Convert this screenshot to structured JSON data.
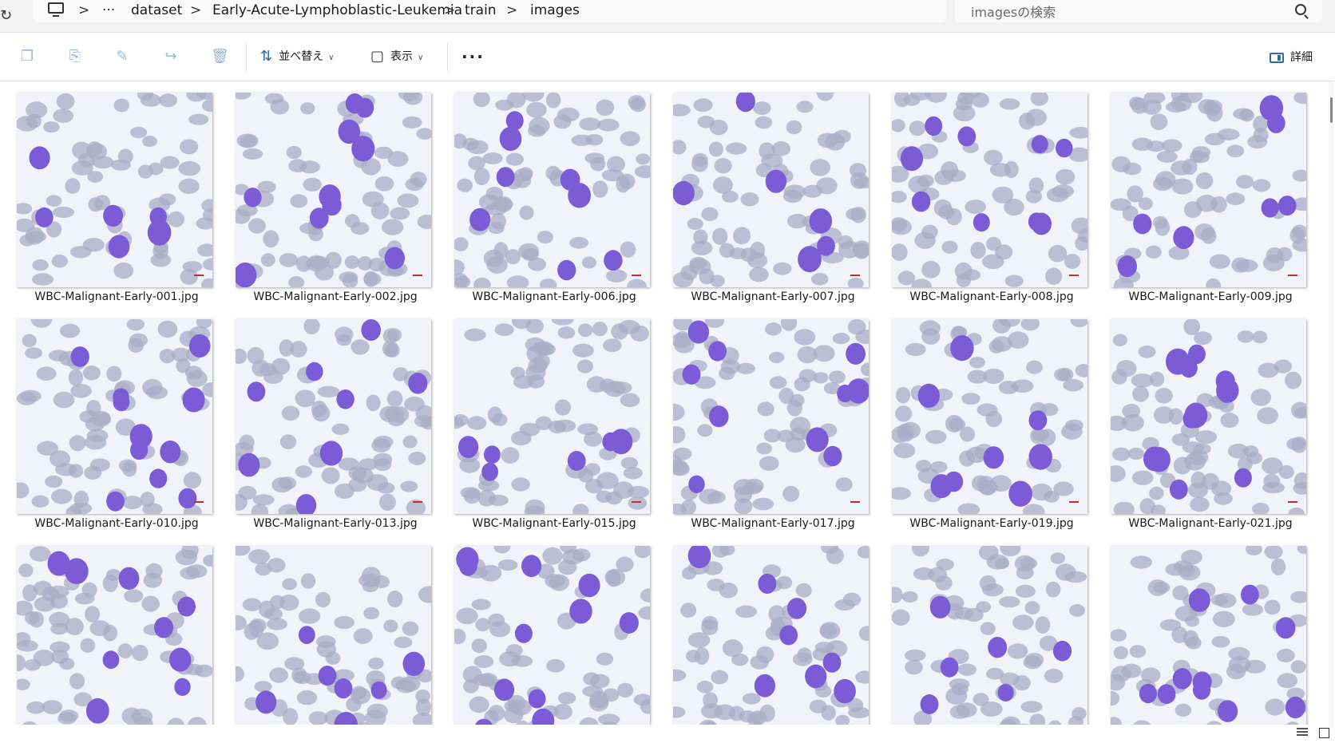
{
  "window": {
    "title": "images"
  },
  "address_bar": {
    "breadcrumbs": [
      "dataset",
      "Early-Acute-Lymphoblastic-Leukemia",
      "train",
      "images"
    ],
    "overflow_label": "···",
    "separator": ">"
  },
  "search": {
    "placeholder": "imagesの検索"
  },
  "toolbar": {
    "copy_icon": "copy-icon",
    "paste_icon": "paste-icon",
    "rename_icon": "rename-icon",
    "share_icon": "share-icon",
    "delete_icon": "trash-icon",
    "sort_label": "並べ替え",
    "view_label": "表示",
    "more_label": "···",
    "details_label": "詳細"
  },
  "files": [
    "WBC-Malignant-Early-001.jpg",
    "WBC-Malignant-Early-002.jpg",
    "WBC-Malignant-Early-006.jpg",
    "WBC-Malignant-Early-007.jpg",
    "WBC-Malignant-Early-008.jpg",
    "WBC-Malignant-Early-009.jpg",
    "WBC-Malignant-Early-010.jpg",
    "WBC-Malignant-Early-013.jpg",
    "WBC-Malignant-Early-015.jpg",
    "WBC-Malignant-Early-017.jpg",
    "WBC-Malignant-Early-019.jpg",
    "WBC-Malignant-Early-021.jpg",
    "",
    "",
    "",
    "",
    "",
    ""
  ],
  "colors": {
    "cell_purple": "#7b5cd6",
    "rbc_grey": "#a9adc6",
    "background": "#f1f2fa",
    "accent": "#2b6cb0"
  }
}
